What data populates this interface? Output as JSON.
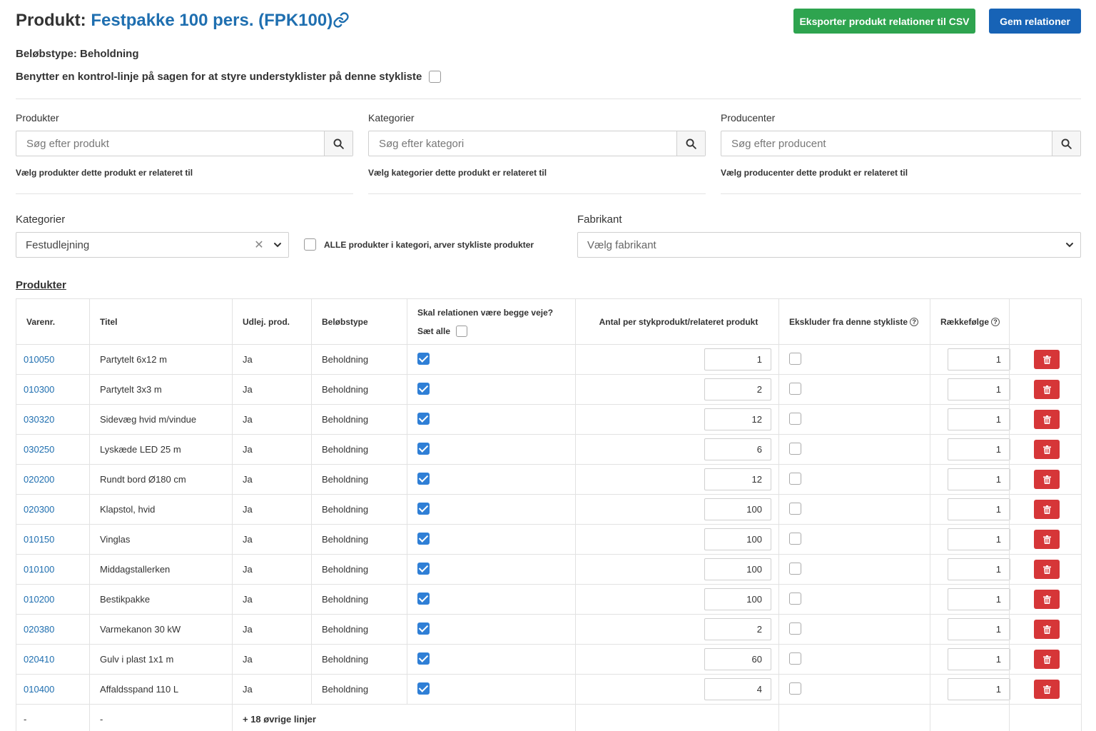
{
  "header": {
    "title_prefix": "Produkt:",
    "product_name": "Festpakke 100 pers. (FPK100)",
    "export_button": "Eksporter produkt relationer til CSV",
    "save_button": "Gem relationer"
  },
  "amount_type": "Beløbstype: Beholdning",
  "control_line_label": "Benytter en kontrol-linje på sagen for at styre understyklister på denne stykliste",
  "search_groups": {
    "products": {
      "label": "Produkter",
      "placeholder": "Søg efter produkt",
      "help": "Vælg produkter dette produkt er relateret til"
    },
    "categories": {
      "label": "Kategorier",
      "placeholder": "Søg efter kategori",
      "help": "Vælg kategorier dette produkt er relateret til"
    },
    "producers": {
      "label": "Producenter",
      "placeholder": "Søg efter producent",
      "help": "Vælg producenter dette produkt er relateret til"
    }
  },
  "category_filter": {
    "label": "Kategorier",
    "selected": "Festudlejning",
    "all_products_label": "ALLE produkter i kategori, arver stykliste produkter"
  },
  "manufacturer_filter": {
    "label": "Fabrikant",
    "placeholder": "Vælg fabrikant"
  },
  "products_heading": "Produkter",
  "table": {
    "headers": {
      "varenr": "Varenr.",
      "titel": "Titel",
      "udlej": "Udlej. prod.",
      "belobstype": "Beløbstype",
      "bidirectional": "Skal relationen være begge veje?",
      "set_all": "Sæt alle",
      "antal": "Antal per stykprodukt/relateret produkt",
      "exclude": "Ekskluder fra denne stykliste",
      "order": "Rækkefølge"
    },
    "rows": [
      {
        "varenr": "010050",
        "titel": "Partytelt 6x12 m",
        "udlej": "Ja",
        "belobstype": "Beholdning",
        "bidirectional": true,
        "antal": "1",
        "exclude": false,
        "order": "1"
      },
      {
        "varenr": "010300",
        "titel": "Partytelt 3x3 m",
        "udlej": "Ja",
        "belobstype": "Beholdning",
        "bidirectional": true,
        "antal": "2",
        "exclude": false,
        "order": "1"
      },
      {
        "varenr": "030320",
        "titel": "Sidevæg hvid m/vindue",
        "udlej": "Ja",
        "belobstype": "Beholdning",
        "bidirectional": true,
        "antal": "12",
        "exclude": false,
        "order": "1"
      },
      {
        "varenr": "030250",
        "titel": "Lyskæde LED 25 m",
        "udlej": "Ja",
        "belobstype": "Beholdning",
        "bidirectional": true,
        "antal": "6",
        "exclude": false,
        "order": "1"
      },
      {
        "varenr": "020200",
        "titel": "Rundt bord Ø180 cm",
        "udlej": "Ja",
        "belobstype": "Beholdning",
        "bidirectional": true,
        "antal": "12",
        "exclude": false,
        "order": "1"
      },
      {
        "varenr": "020300",
        "titel": "Klapstol, hvid",
        "udlej": "Ja",
        "belobstype": "Beholdning",
        "bidirectional": true,
        "antal": "100",
        "exclude": false,
        "order": "1"
      },
      {
        "varenr": "010150",
        "titel": "Vinglas",
        "udlej": "Ja",
        "belobstype": "Beholdning",
        "bidirectional": true,
        "antal": "100",
        "exclude": false,
        "order": "1"
      },
      {
        "varenr": "010100",
        "titel": "Middagstallerken",
        "udlej": "Ja",
        "belobstype": "Beholdning",
        "bidirectional": true,
        "antal": "100",
        "exclude": false,
        "order": "1"
      },
      {
        "varenr": "010200",
        "titel": "Bestikpakke",
        "udlej": "Ja",
        "belobstype": "Beholdning",
        "bidirectional": true,
        "antal": "100",
        "exclude": false,
        "order": "1"
      },
      {
        "varenr": "020380",
        "titel": "Varmekanon 30 kW",
        "udlej": "Ja",
        "belobstype": "Beholdning",
        "bidirectional": true,
        "antal": "2",
        "exclude": false,
        "order": "1"
      },
      {
        "varenr": "020410",
        "titel": "Gulv i plast 1x1 m",
        "udlej": "Ja",
        "belobstype": "Beholdning",
        "bidirectional": true,
        "antal": "60",
        "exclude": false,
        "order": "1"
      },
      {
        "varenr": "010400",
        "titel": "Affaldsspand 110 L",
        "udlej": "Ja",
        "belobstype": "Beholdning",
        "bidirectional": true,
        "antal": "4",
        "exclude": false,
        "order": "1"
      }
    ],
    "more_row": {
      "varenr": "-",
      "titel": "-",
      "label": "+ 18 øvrige linjer"
    }
  },
  "icons": {
    "link": "link-icon",
    "search": "search-icon",
    "delete": "trash-icon",
    "clear": "close-icon",
    "chevron": "chevron-down-icon",
    "help": "help-icon"
  },
  "colors": {
    "link": "#1f6fb0",
    "export_button": "#2ea44f",
    "save_button": "#1763b6",
    "delete_button": "#d63638",
    "checkbox_checked": "#2f7fd6"
  }
}
